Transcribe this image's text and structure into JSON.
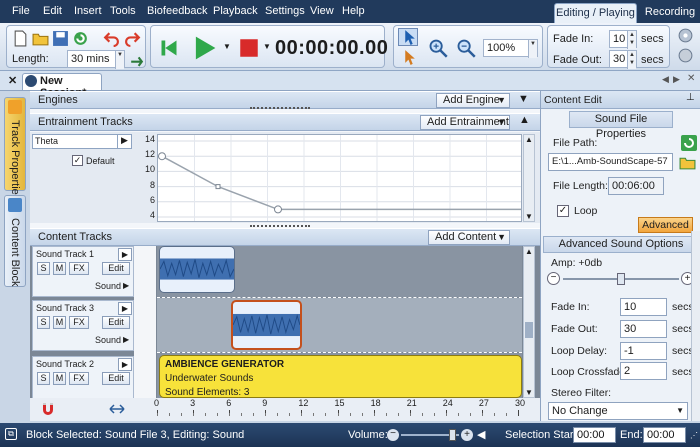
{
  "menu": {
    "items": [
      "File",
      "Edit",
      "Insert",
      "Tools",
      "Biofeedback",
      "Playback",
      "Settings",
      "View",
      "Help"
    ],
    "tabs": [
      "Editing / Playing",
      "Recording"
    ]
  },
  "toolbar": {
    "length_label": "Length:",
    "length_value": "30 mins",
    "time_display": "00:00:00.00",
    "zoom_value": "100%",
    "fade_in_label": "Fade In:",
    "fade_in_value": "10",
    "fade_out_label": "Fade Out:",
    "fade_out_value": "30",
    "secs": "secs"
  },
  "doc_tab": {
    "title": "New Session*"
  },
  "side_tabs": [
    "Track Properties",
    "Content Block"
  ],
  "engines": {
    "title": "Engines",
    "button": "Add Engine"
  },
  "entrainment": {
    "title": "Entrainment Tracks",
    "button": "Add Entrainment",
    "track_select": "Theta",
    "default_label": "Default",
    "y_ticks": [
      "14",
      "12",
      "10",
      "8",
      "6",
      "4"
    ],
    "chart_data": {
      "type": "line",
      "x": [
        0,
        1,
        2
      ],
      "y": [
        12,
        8,
        5
      ],
      "ylim": [
        4,
        14
      ]
    }
  },
  "content": {
    "title": "Content Tracks",
    "button": "Add Content",
    "tracks": [
      {
        "name": "Sound Track 1",
        "s": "S",
        "m": "M",
        "fx": "FX",
        "edit": "Edit",
        "type": "Sound"
      },
      {
        "name": "Sound Track 3",
        "s": "S",
        "m": "M",
        "fx": "FX",
        "edit": "Edit",
        "type": "Sound"
      },
      {
        "name": "Sound Track 2",
        "s": "S",
        "m": "M",
        "fx": "FX",
        "edit": "Edit",
        "type": "Sound"
      }
    ],
    "generator": {
      "title": "AMBIENCE GENERATOR",
      "line1": "Underwater Sounds",
      "line2": "Sound Elements: 3"
    },
    "ruler": [
      "0",
      "3",
      "6",
      "9",
      "12",
      "15",
      "18",
      "21",
      "24",
      "27",
      "30"
    ]
  },
  "right_panel": {
    "title": "Content Edit",
    "sound_props_title": "Sound File Properties",
    "file_path_label": "File Path:",
    "file_path_value": "E:\\1...Amb-SoundScape-57",
    "file_length_label": "File Length:",
    "file_length_value": "00:06:00",
    "loop_label": "Loop",
    "advanced_button": "Advanced",
    "adv_title": "Advanced Sound Options",
    "amp_label": "Amp: +0db",
    "fade_in_label": "Fade In:",
    "fade_in_value": "10",
    "fade_out_label": "Fade Out:",
    "fade_out_value": "30",
    "loop_delay_label": "Loop Delay:",
    "loop_delay_value": "-1",
    "loop_crossfade_label": "Loop Crossfade:",
    "loop_crossfade_value": "2",
    "secs": "secs",
    "stereo_label": "Stereo Filter:",
    "stereo_value": "No Change"
  },
  "status": {
    "text": "Block Selected: Sound File 3, Editing:  Sound",
    "volume_label": "Volume:",
    "sel_start_label": "Selection Start:",
    "sel_start_value": "00:00",
    "end_label": "End:",
    "end_value": "00:00"
  },
  "colors": {
    "accent": "#213a5c",
    "generator": "#f7e23a",
    "wave": "#3f6fb0",
    "play": "#2fa84a",
    "record": "#d82a2a"
  }
}
